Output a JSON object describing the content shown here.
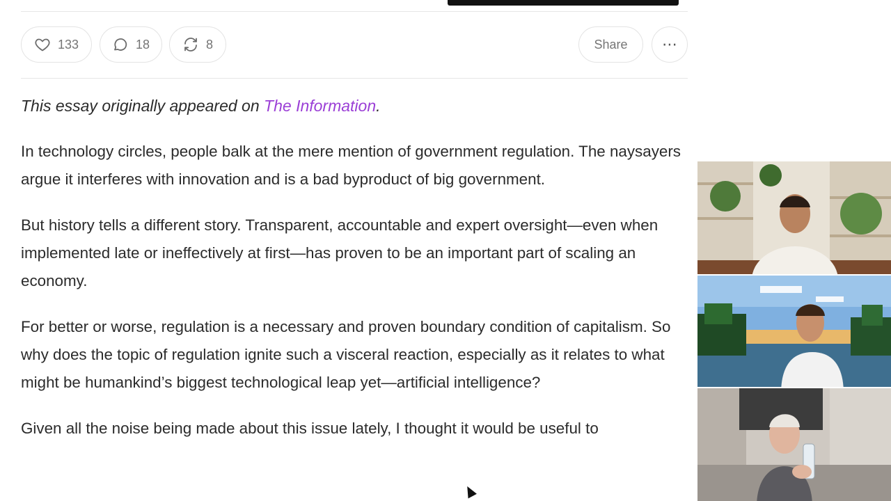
{
  "actions": {
    "like_count": "133",
    "comment_count": "18",
    "restack_count": "8",
    "share_label": "Share",
    "more_label": "⋯"
  },
  "article": {
    "intro_prefix": "This essay originally appeared on ",
    "intro_link": "The Information",
    "intro_suffix": ".",
    "paragraphs": [
      "In technology circles, people balk at the mere mention of government regulation. The naysayers argue it interferes with innovation and is a bad byproduct of big government.",
      "But history tells a different story. Transparent, accountable and expert oversight—even when implemented late or ineffectively at first—has proven to be an important part of scaling an economy.",
      "For better or worse, regulation is a necessary and proven boundary condition of capitalism. So why does the topic of regulation ignite such a visceral reaction, especially as it relates to what might be humankind’s biggest technological leap yet—artificial intelligence?",
      "Given all the noise being made about this issue lately, I thought it would be useful to"
    ]
  },
  "colors": {
    "link": "#9b3fd6",
    "text": "#2b2b2b",
    "icon": "#6b6b6b",
    "border": "#e3e3e3"
  },
  "icons": [
    "heart-icon",
    "comment-icon",
    "restack-icon",
    "more-icon"
  ],
  "video_tiles": [
    "participant-1",
    "participant-2",
    "participant-3"
  ]
}
